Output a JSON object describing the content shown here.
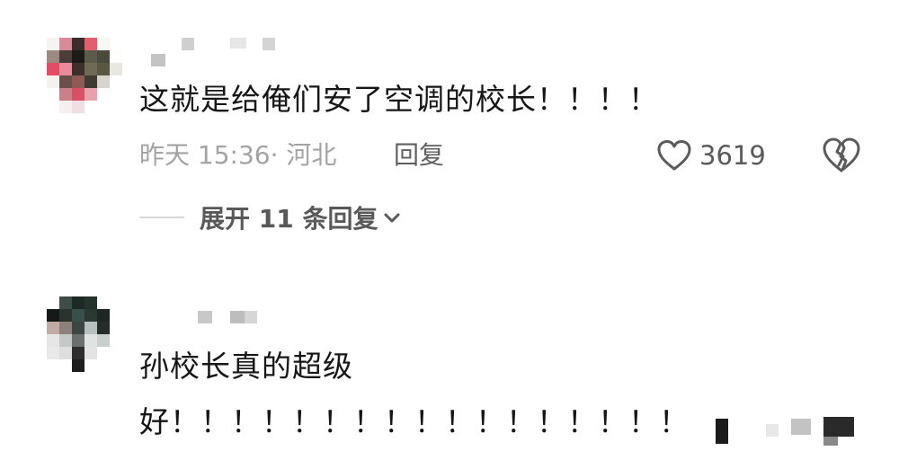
{
  "comments": [
    {
      "text": "这就是给俺们安了空调的校长！！！！",
      "meta": "昨天 15:36· 河北",
      "reply_label": "回复",
      "like_count": "3619",
      "expand_label": "展开 11 条回复"
    },
    {
      "text_line1": "孙校长真的超级",
      "text_line2": "好！！！！！！！！！！！！！！！！！"
    }
  ],
  "colors": {
    "text": "#161616",
    "meta": "#a3a3a3",
    "action": "#5f5f5f"
  },
  "icons": {
    "like": "heart-outline-icon",
    "dislike": "broken-heart-icon",
    "expand": "chevron-down-icon"
  }
}
